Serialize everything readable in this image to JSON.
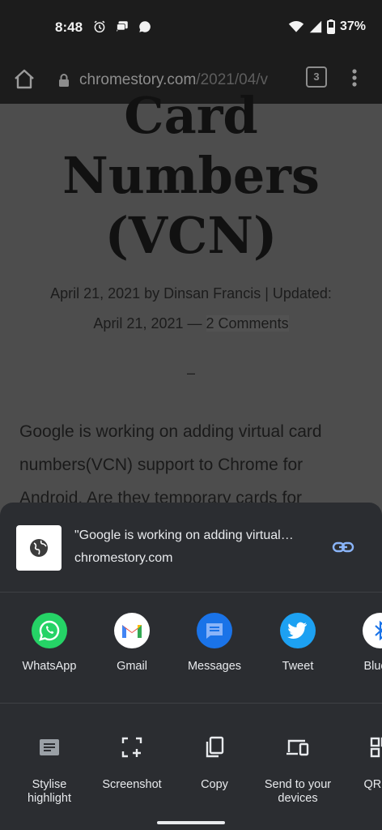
{
  "status_bar": {
    "time": "8:48",
    "battery": "37%"
  },
  "toolbar": {
    "url_host": "chromestory.com",
    "url_path": "/2021/04/v",
    "tab_count": "3"
  },
  "article": {
    "title_line1": "Card",
    "title_line2": "Numbers",
    "title_line3": "(VCN)",
    "meta_line1": "April 21, 2021 by Dinsan Francis | Updated:",
    "meta_date2": "April 21, 2021",
    "meta_dash": "—",
    "comments": "2 Comments",
    "separator": "–",
    "body_line1": "Google is working on adding virtual card",
    "body_line2": "numbers(VCN) support to Chrome for",
    "body_line3": "Android. Are they temporary cards for"
  },
  "share_sheet": {
    "preview_title": "\"Google is working on adding virtual…",
    "preview_url": "chromestory.com",
    "apps": [
      {
        "label": "WhatsApp",
        "icon": "whatsapp-icon",
        "color": "#25d366"
      },
      {
        "label": "Gmail",
        "icon": "gmail-icon",
        "color": "#ffffff"
      },
      {
        "label": "Messages",
        "icon": "messages-icon",
        "color": "#1a73e8"
      },
      {
        "label": "Tweet",
        "icon": "twitter-icon",
        "color": "#1da1f2"
      },
      {
        "label": "Blueto",
        "icon": "bluetooth-icon",
        "color": "#ffffff"
      }
    ],
    "actions": [
      {
        "label": "Stylise highlight",
        "icon": "highlight-icon"
      },
      {
        "label": "Screenshot",
        "icon": "screenshot-icon"
      },
      {
        "label": "Copy",
        "icon": "copy-icon"
      },
      {
        "label": "Send to your devices",
        "icon": "send-to-devices-icon"
      },
      {
        "label": "QR co",
        "icon": "qr-code-icon"
      }
    ]
  }
}
